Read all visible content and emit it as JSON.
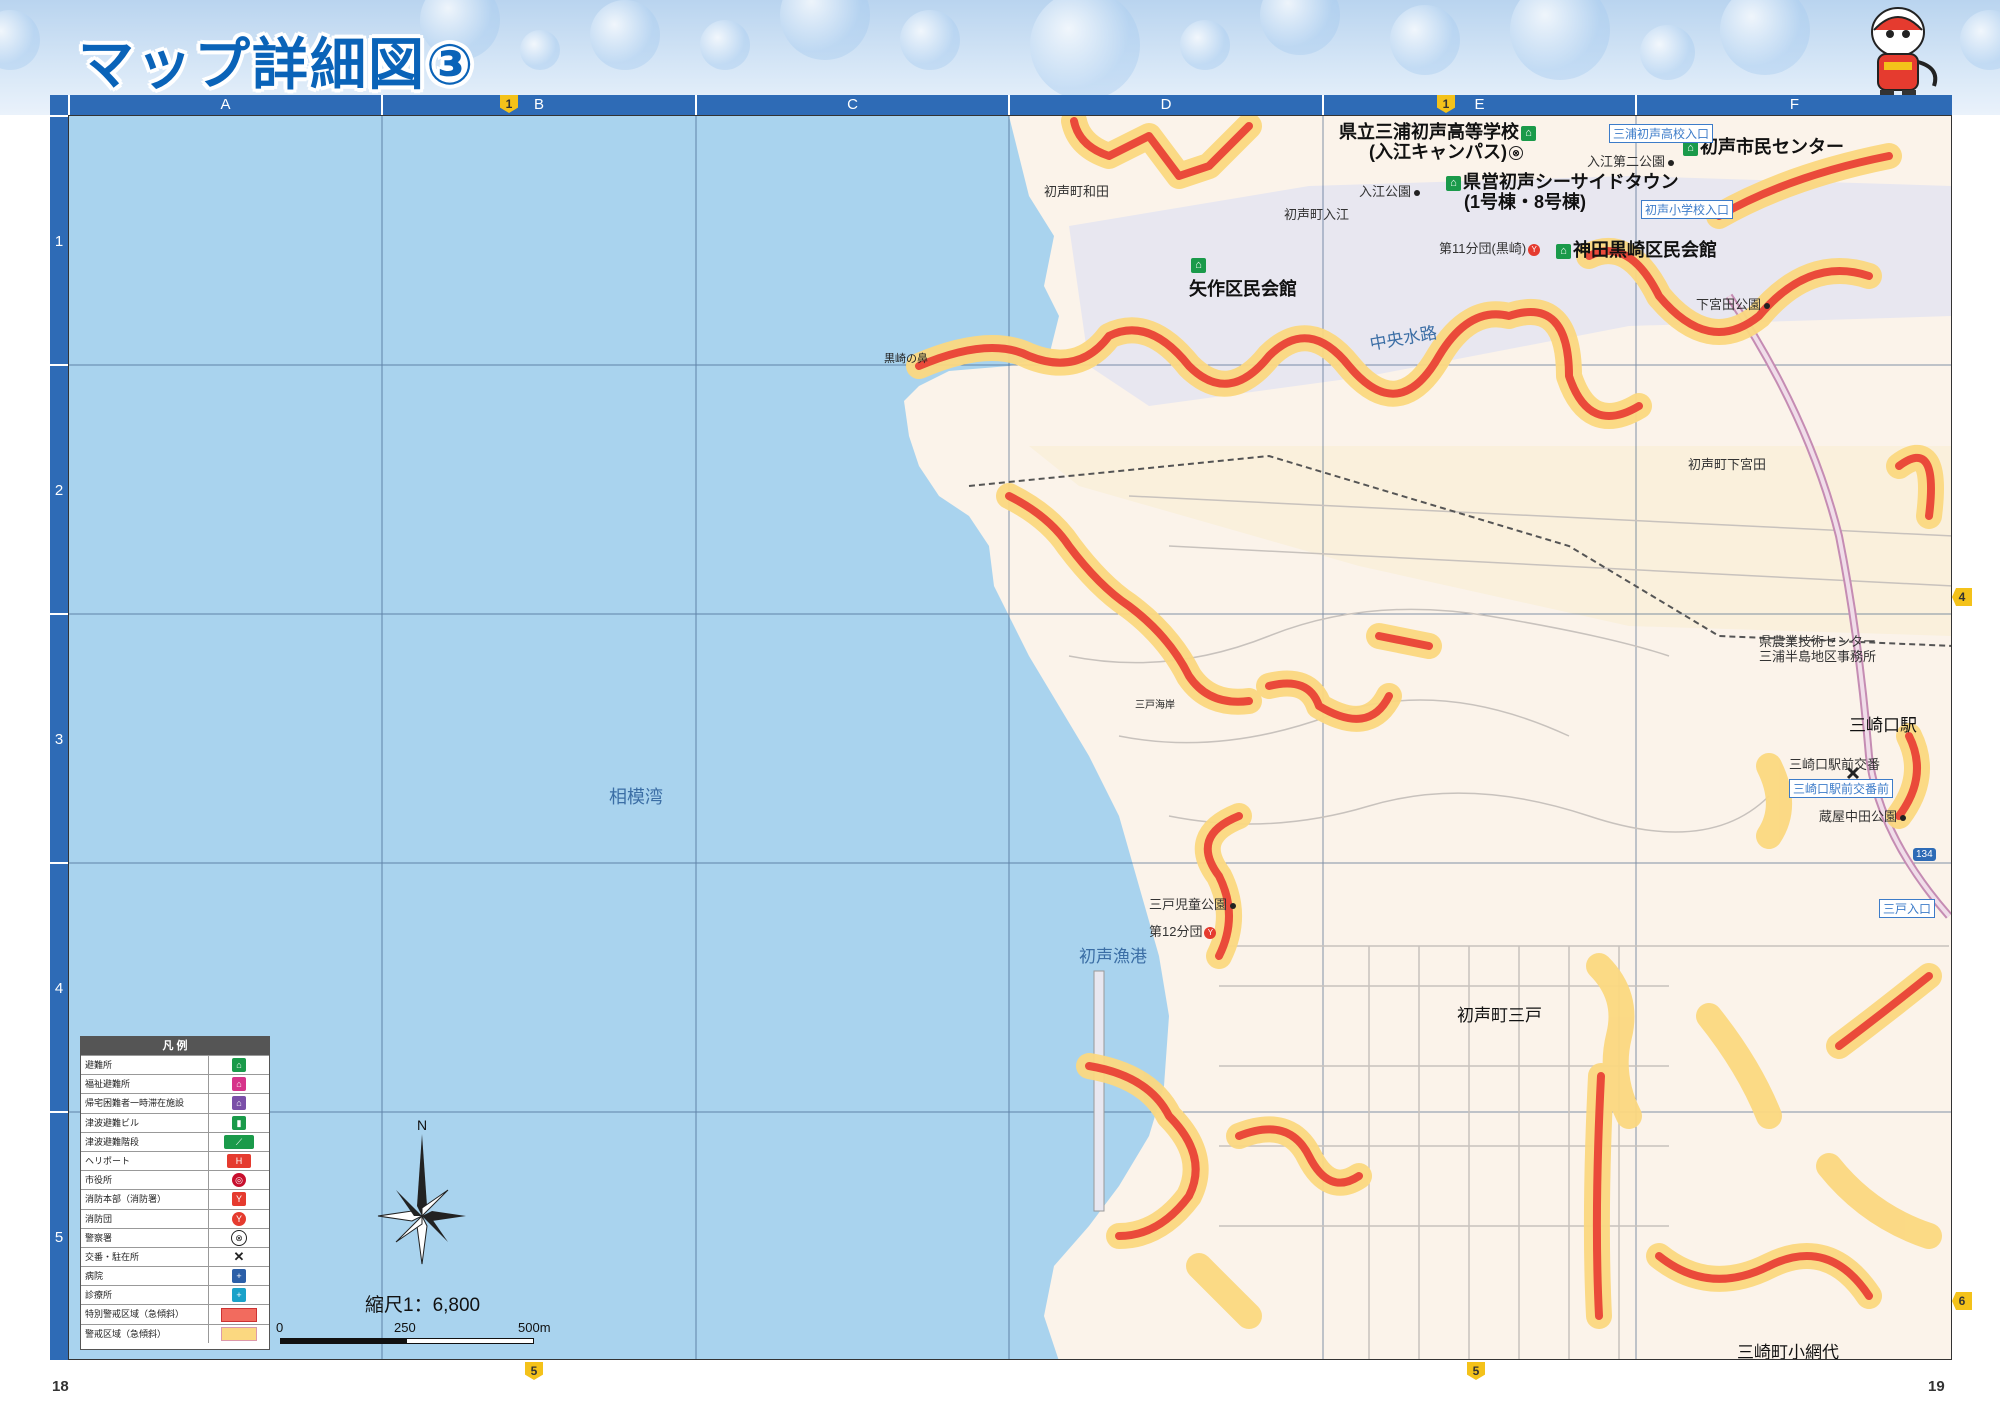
{
  "header": {
    "title": "マップ詳細図③"
  },
  "columns": [
    "A",
    "B",
    "C",
    "D",
    "E",
    "F"
  ],
  "rows": [
    "1",
    "2",
    "3",
    "4",
    "5"
  ],
  "page_markers": {
    "top": [
      {
        "label": "1",
        "col": "B"
      },
      {
        "label": "1",
        "col": "E"
      }
    ],
    "bottom": [
      {
        "label": "5"
      },
      {
        "label": "5"
      }
    ],
    "right": [
      {
        "label": "4"
      },
      {
        "label": "6"
      }
    ]
  },
  "map_labels": {
    "sea": "相模湾",
    "fishing_port": "初声漁港",
    "channel": "中央水路",
    "cape": "黒崎の鼻",
    "misaki_coast": "三戸海岸",
    "area_wada": "初声町和田",
    "area_irie": "初声町入江",
    "area_shimomiyada": "初声町下宮田",
    "area_mito": "初声町三戸",
    "area_koamishiro": "三崎町小網代",
    "irie_park": "入江公園",
    "irie_park2": "入江第二公園",
    "shimomiyada_park": "下宮田公園",
    "agri_center_1": "県農業技術センター",
    "agri_center_2": "三浦半島地区事務所",
    "misakiguchi_station": "三崎口駅",
    "koban": "三崎口駅前交番",
    "nakata_park": "蔵屋中田公園",
    "mito_park": "三戸児童公園",
    "fire_12": "第12分団",
    "fire_11": "第11分団(黒崎)",
    "school_1": "県立三浦初声高等学校",
    "school_2": "(入江キャンパス)",
    "civic_center": "初声市民センター",
    "seaside_1": "県営初声シーサイドタウン",
    "seaside_2": "(1号棟・8号棟)",
    "yasaku_hall": "矢作区民会館",
    "kanda_hall": "神田黒崎区民会館",
    "route_134": "134"
  },
  "road_tags": {
    "hs_entrance": "三浦初声高校入口",
    "es_entrance": "初声小学校入口",
    "ekimae": "三崎口駅前交番前",
    "mito_entrance": "三戸入口"
  },
  "legend": {
    "title": "凡 例",
    "items": [
      {
        "label": "避難所",
        "icon": "shelter-icon",
        "color": "#1a9a4a"
      },
      {
        "label": "福祉避難所",
        "icon": "welfare-shelter-icon",
        "color": "#d6338a"
      },
      {
        "label": "帰宅困難者一時滞在施設",
        "icon": "temporary-stay-icon",
        "color": "#7a4fa8"
      },
      {
        "label": "津波避難ビル",
        "icon": "tsunami-building-icon",
        "color": "#1a9a4a"
      },
      {
        "label": "津波避難階段",
        "icon": "tsunami-stairs-icon",
        "color": "#1a9a4a"
      },
      {
        "label": "ヘリポート",
        "icon": "heliport-icon",
        "color": "#e53b2f"
      },
      {
        "label": "市役所",
        "icon": "city-hall-icon",
        "color": "#c8102e"
      },
      {
        "label": "消防本部（消防署）",
        "icon": "fire-hq-icon",
        "color": "#e53b2f"
      },
      {
        "label": "消防団",
        "icon": "fire-brigade-icon",
        "color": "#e53b2f"
      },
      {
        "label": "警察署",
        "icon": "police-icon",
        "color": "#222222"
      },
      {
        "label": "交番・駐在所",
        "icon": "koban-icon",
        "color": "#222222"
      },
      {
        "label": "病院",
        "icon": "hospital-icon",
        "color": "#2b5fa8"
      },
      {
        "label": "診療所",
        "icon": "clinic-icon",
        "color": "#1aa2c9"
      },
      {
        "label": "特別警戒区域（急傾斜）",
        "icon": "special-zone-swatch",
        "color": "#f26b5e"
      },
      {
        "label": "警戒区域（急傾斜）",
        "icon": "warning-zone-swatch",
        "color": "#fbd880"
      }
    ]
  },
  "scale": {
    "title": "縮尺1：6,800",
    "ticks": [
      "0",
      "250",
      "500m"
    ]
  },
  "page_numbers": {
    "left": "18",
    "right": "19"
  },
  "colors": {
    "sea": "#a9d3ee",
    "land": "#fbf3ea",
    "reclaimed": "#faf0dc",
    "header_blue": "#2e6bb6",
    "special_zone": "#ea4a3a",
    "warning_zone": "#fbd880"
  }
}
